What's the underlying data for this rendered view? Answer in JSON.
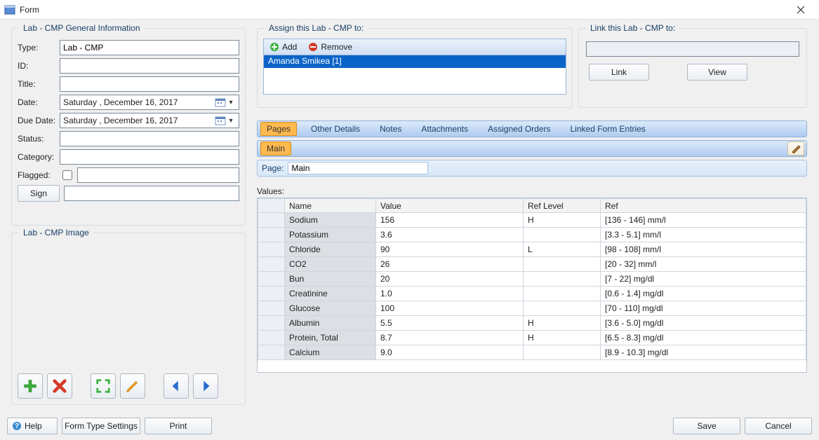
{
  "window": {
    "title": "Form"
  },
  "groups": {
    "general": "Lab - CMP General Information",
    "image": "Lab - CMP Image",
    "assign": "Assign this Lab - CMP to:",
    "link": "Link this Lab - CMP to:"
  },
  "general": {
    "type_label": "Type:",
    "type_value": "Lab - CMP",
    "id_label": "ID:",
    "id_value": "",
    "title_label": "Title:",
    "title_value": "",
    "date_label": "Date:",
    "date_value": "Saturday  , December 16, 2017",
    "due_label": "Due Date:",
    "due_value": "Saturday  , December 16, 2017",
    "status_label": "Status:",
    "status_value": "",
    "category_label": "Category:",
    "category_value": "",
    "flagged_label": "Flagged:",
    "flagged_checked": false,
    "flagged_text": "",
    "sign_label": "Sign",
    "sign_text": ""
  },
  "assign": {
    "add_label": "Add",
    "remove_label": "Remove",
    "items": [
      {
        "label": "Amanda Smikea [1]",
        "selected": true
      }
    ]
  },
  "link": {
    "value": "",
    "link_btn": "Link",
    "view_btn": "View"
  },
  "tabs": {
    "pages": "Pages",
    "other": "Other Details",
    "notes": "Notes",
    "attachments": "Attachments",
    "assigned": "Assigned Orders",
    "linked": "Linked Form Entries"
  },
  "subtab": {
    "main": "Main"
  },
  "pagebar": {
    "label": "Page:",
    "value": "Main"
  },
  "values": {
    "caption": "Values:",
    "headers": {
      "name": "Name",
      "value": "Value",
      "reflevel": "Ref Level",
      "ref": "Ref"
    },
    "rows": [
      {
        "name": "Sodium",
        "value": "156",
        "reflevel": "H",
        "ref": "[136 - 146]  mm/l"
      },
      {
        "name": "Potassium",
        "value": "3.6",
        "reflevel": "",
        "ref": "[3.3 - 5.1]  mm/l"
      },
      {
        "name": "Chloride",
        "value": "90",
        "reflevel": "L",
        "ref": "[98 - 108]  mm/l"
      },
      {
        "name": "CO2",
        "value": "26",
        "reflevel": "",
        "ref": "[20 - 32]  mm/l"
      },
      {
        "name": "Bun",
        "value": "20",
        "reflevel": "",
        "ref": "[7 - 22]  mg/dl"
      },
      {
        "name": "Creatinine",
        "value": "1.0",
        "reflevel": "",
        "ref": "[0.6 - 1.4]  mg/dl"
      },
      {
        "name": "Glucose",
        "value": "100",
        "reflevel": "",
        "ref": "[70 - 110]  mg/dl"
      },
      {
        "name": "Albumin",
        "value": "5.5",
        "reflevel": "H",
        "ref": "[3.6 - 5.0]  mg/dl"
      },
      {
        "name": "Protein, Total",
        "value": "8.7",
        "reflevel": "H",
        "ref": "[6.5 - 8.3]  mg/dl"
      },
      {
        "name": "Calcium",
        "value": "9.0",
        "reflevel": "",
        "ref": "[8.9 - 10.3]  mg/dl"
      }
    ]
  },
  "bottom": {
    "help": "Help",
    "fts": "Form Type Settings",
    "print": "Print",
    "save": "Save",
    "cancel": "Cancel"
  }
}
